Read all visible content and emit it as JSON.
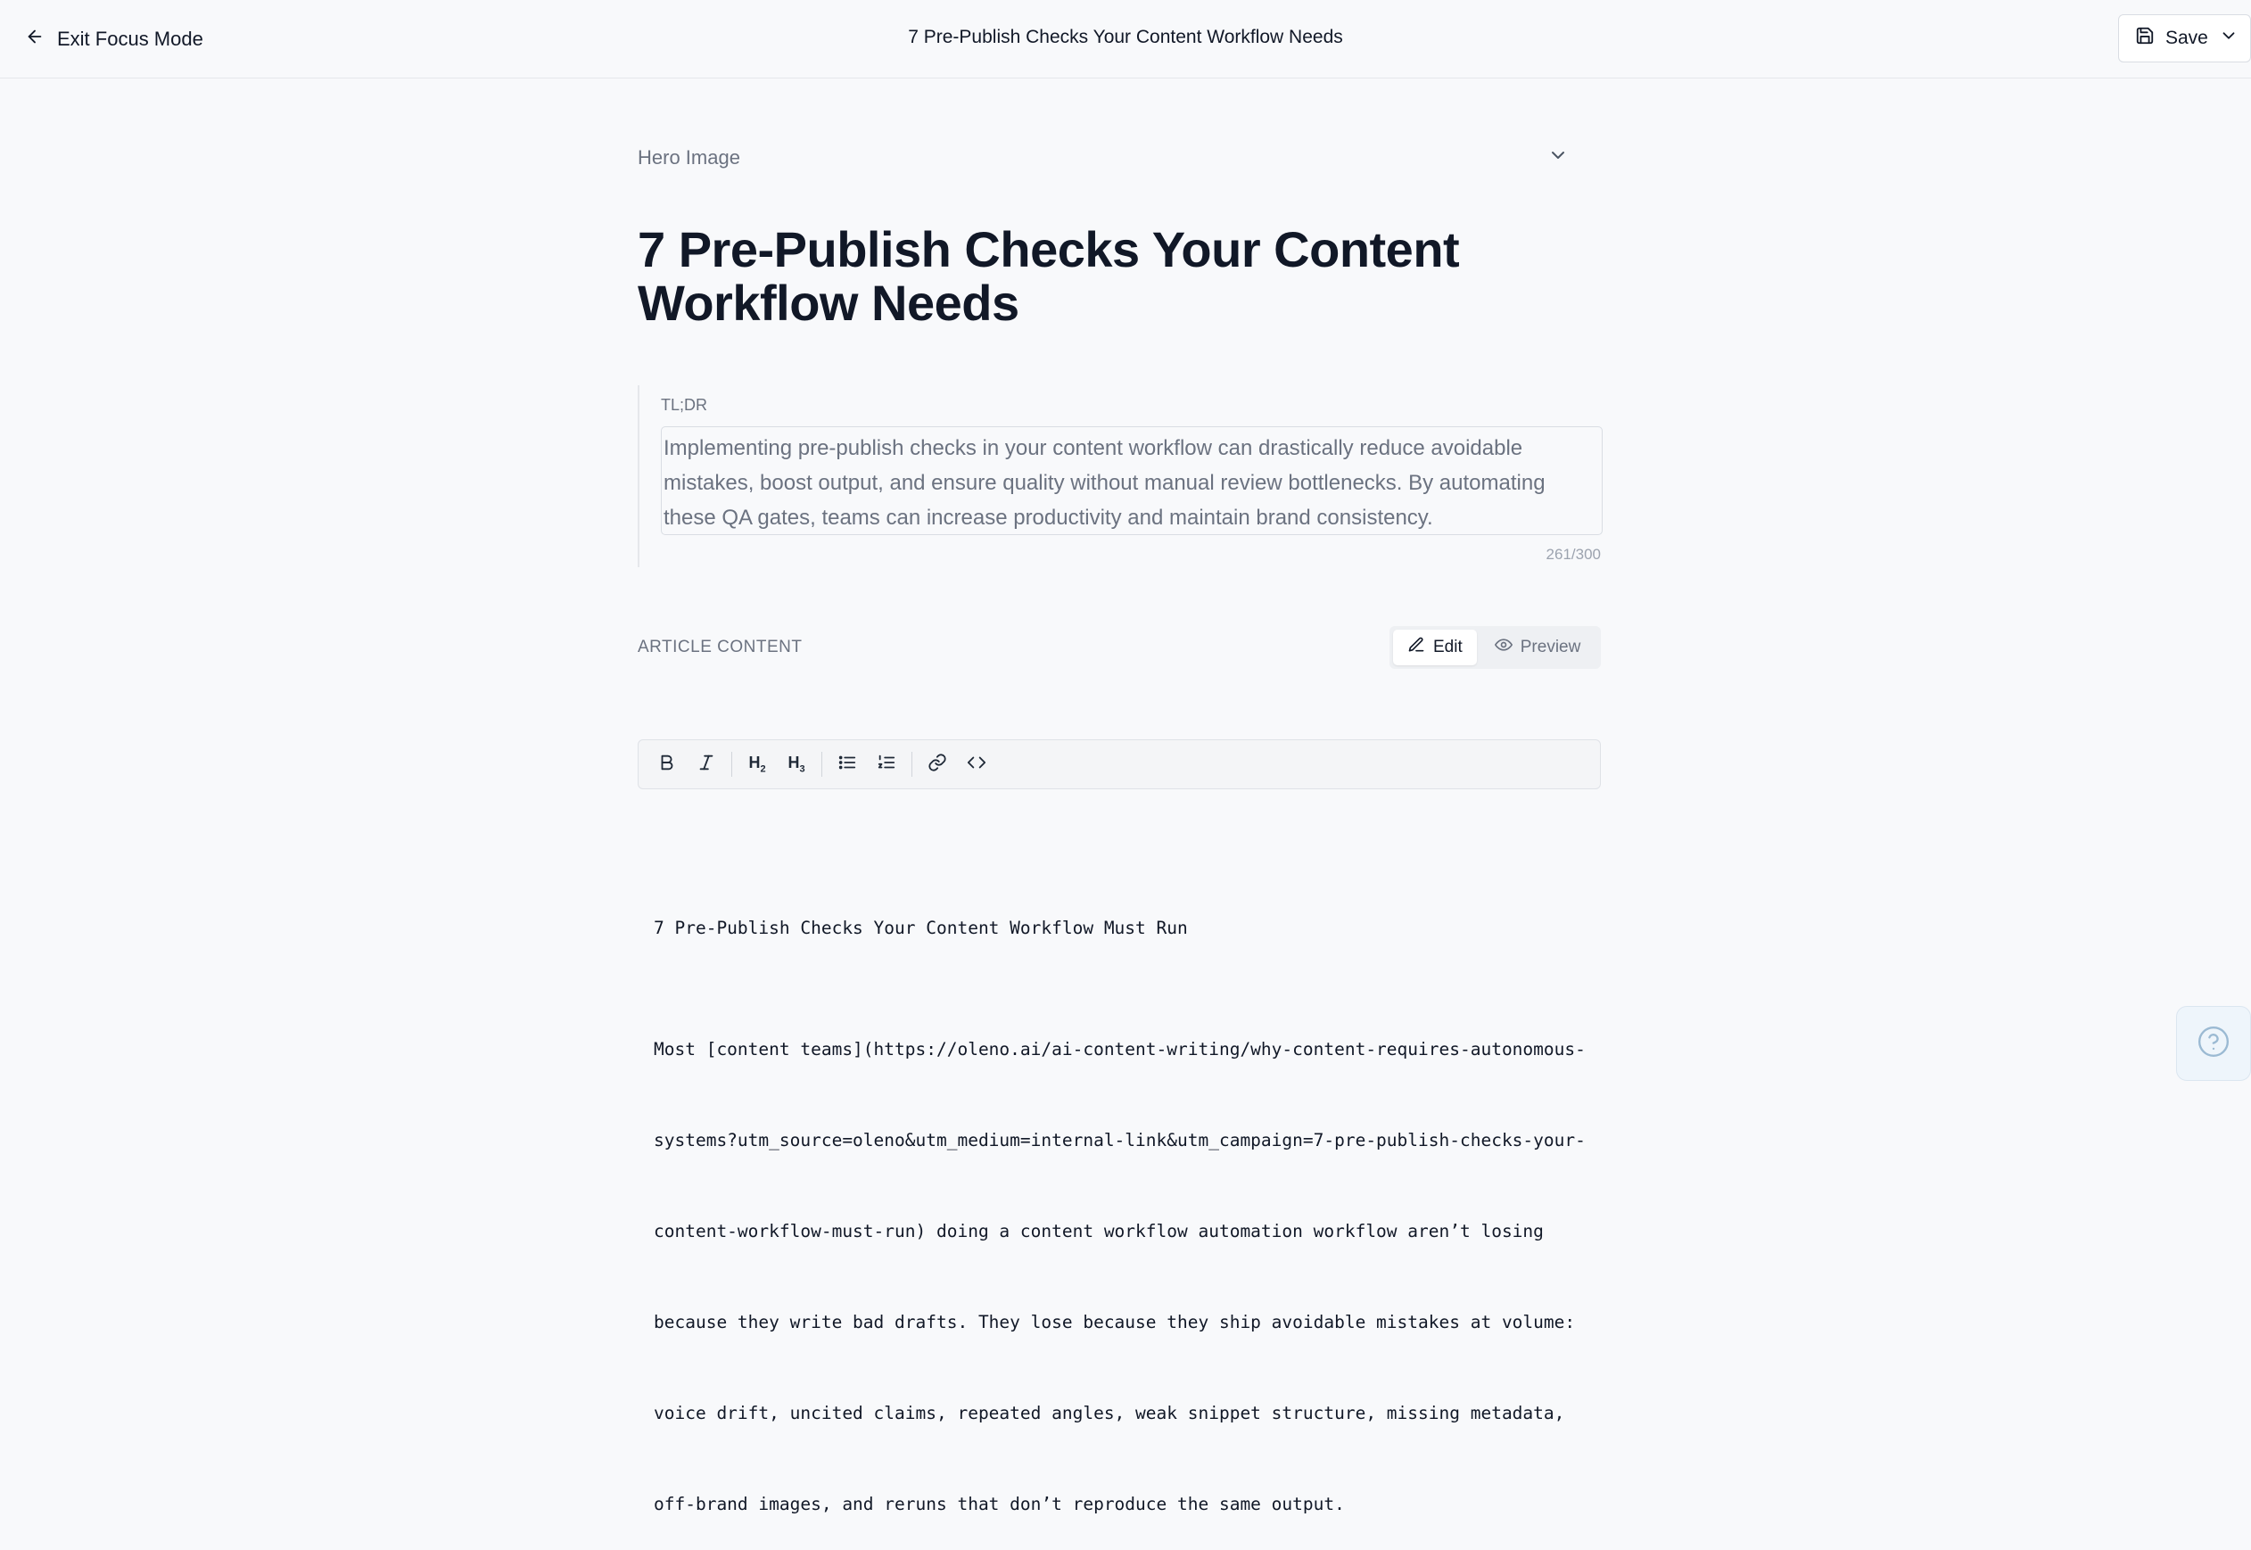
{
  "header": {
    "exit_label": "Exit Focus Mode",
    "document_title": "7 Pre-Publish Checks Your Content Workflow Needs",
    "save_label": "Save"
  },
  "hero": {
    "label": "Hero Image"
  },
  "article": {
    "title": "7 Pre-Publish Checks Your Content Workflow Needs"
  },
  "tldr": {
    "label": "TL;DR",
    "text": "Implementing pre-publish checks in your content workflow can drastically reduce avoidable mistakes, boost output, and ensure quality without manual review bottlenecks. By automating these QA gates, teams can increase productivity and maintain brand consistency.",
    "char_count": "261/300"
  },
  "content": {
    "section_label": "ARTICLE CONTENT",
    "edit_label": "Edit",
    "preview_label": "Preview",
    "active_mode": "Edit"
  },
  "toolbar": {
    "items": [
      "bold",
      "italic",
      "h2",
      "h3",
      "bullet-list",
      "ordered-list",
      "link",
      "code"
    ],
    "h2_label": "H",
    "h3_label": "H"
  },
  "editor": {
    "heading_line": "7 Pre-Publish Checks Your Content Workflow Must Run",
    "body_lines": [
      "Most [content teams](https://oleno.ai/ai-content-writing/why-content-requires-autonomous-",
      "systems?utm_source=oleno&utm_medium=internal-link&utm_campaign=7-pre-publish-checks-your-",
      "content-workflow-must-run) doing a content workflow automation workflow aren’t losing",
      "because they write bad drafts. They lose because they ship avoidable mistakes at volume:",
      "voice drift, uncited claims, repeated angles, weak snippet structure, missing metadata,",
      "off-brand images, and reruns that don’t reproduce the same output."
    ]
  },
  "colors": {
    "background": "#f8f9fb",
    "border": "#e5e7eb",
    "muted_text": "#6b7280",
    "help_accent": "#9bbad3"
  }
}
